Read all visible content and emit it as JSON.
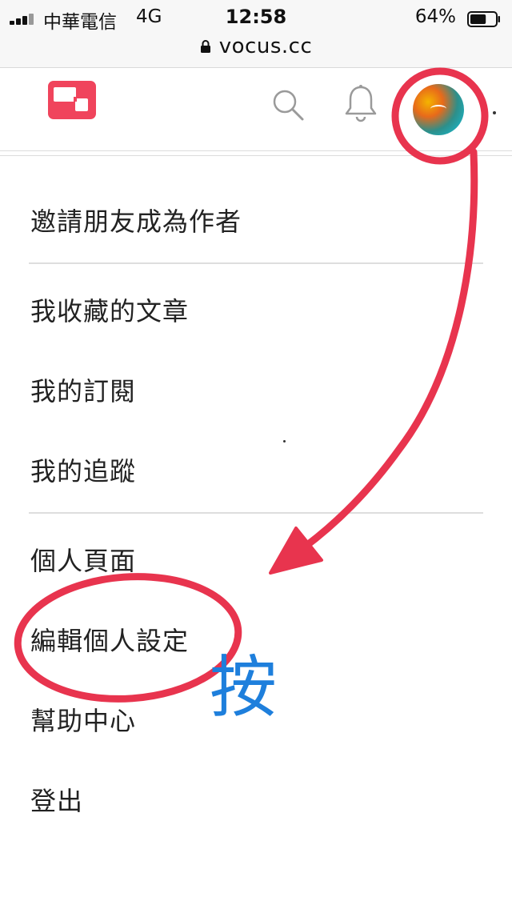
{
  "status_bar": {
    "carrier": "中華電信",
    "network": "4G",
    "time": "12:58",
    "battery_percent": "64%",
    "battery_level": 0.64,
    "url": "vocus.cc"
  },
  "header": {
    "logo_icon": "vocus-logo",
    "search_icon": "search-icon",
    "bell_icon": "bell-icon",
    "avatar_icon": "avatar"
  },
  "menu": {
    "items": [
      {
        "label": "邀請朋友成為作者"
      },
      {
        "label": "我收藏的文章"
      },
      {
        "label": "我的訂閱"
      },
      {
        "label": "我的追蹤"
      },
      {
        "label": "個人頁面"
      },
      {
        "label": "編輯個人設定"
      },
      {
        "label": "幫助中心"
      },
      {
        "label": "登出"
      }
    ]
  },
  "annotation": {
    "press_label": "按",
    "color": "#e8344e",
    "label_color": "#1e7fdc"
  },
  "colors": {
    "brand": "#f0445c",
    "divider": "#dedede"
  }
}
